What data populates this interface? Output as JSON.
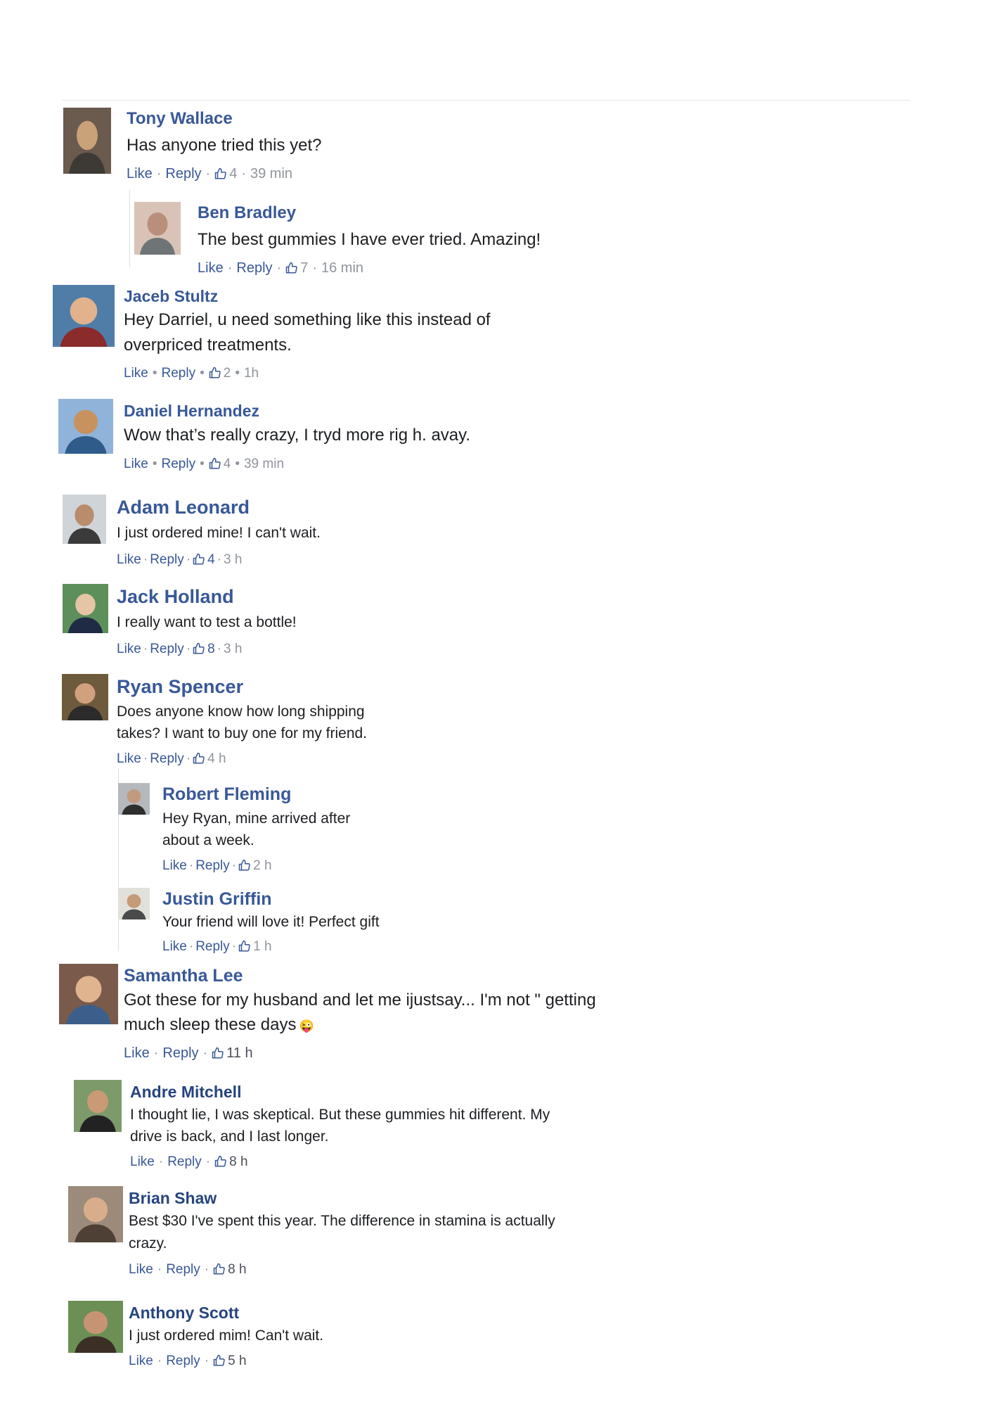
{
  "comments": [
    {
      "name": "Tony Wallace",
      "text": "Has anyone tried this yet?",
      "like": "Like",
      "reply": "Reply",
      "likes": "4",
      "time": "39 min",
      "avatar_colors": [
        "#6b5a4e",
        "#c9a27a",
        "#3d3a36"
      ]
    },
    {
      "name": "Ben Bradley",
      "text": "The best gummies I have ever tried. Amazing!",
      "like": "Like",
      "reply": "Reply",
      "likes": "7",
      "time": "16 min",
      "avatar_colors": [
        "#d9c3b6",
        "#b98f7c",
        "#6f7477"
      ]
    },
    {
      "name": "Jaceb Stultz",
      "text": "Hey Darriel, u need something like this instead of overpriced treatments.",
      "like": "Like",
      "reply": "Reply",
      "likes": "2",
      "time": "1h",
      "avatar_colors": [
        "#4f7da8",
        "#e1b28c",
        "#8b2b2b"
      ]
    },
    {
      "name": "Daniel Hernandez",
      "text": "Wow that’s really crazy, I tryd more rig h. avay.",
      "like": "Like",
      "reply": "Reply",
      "likes": "4",
      "time": "39 min",
      "avatar_colors": [
        "#8fb3d9",
        "#c8925f",
        "#2f5b8a"
      ]
    },
    {
      "name": "Adam Leonard",
      "text": "I just ordered mine! I can't wait.",
      "like": "Like",
      "reply": "Reply",
      "likes": "4",
      "time": "3 h",
      "avatar_colors": [
        "#cfd4d8",
        "#b98c6b",
        "#3a3a3a"
      ]
    },
    {
      "name": "Jack Holland",
      "text": "I really want to test a bottle!",
      "like": "Like",
      "reply": "Reply",
      "likes": "8",
      "time": "3 h",
      "avatar_colors": [
        "#5d8f5a",
        "#e6c4a6",
        "#1f2a44"
      ]
    },
    {
      "name": "Ryan Spencer",
      "text": "Does anyone know how long shipping takes? I want to buy one for my friend.",
      "like": "Like",
      "reply": "Reply",
      "likes": "",
      "time": "4 h",
      "avatar_colors": [
        "#6e5a3c",
        "#d1a07d",
        "#2b2b2b"
      ]
    },
    {
      "name": "Robert Fleming",
      "text": "Hey Ryan, mine arrived after about a week.",
      "like": "Like",
      "reply": "Reply",
      "likes": "",
      "time": "2 h",
      "avatar_colors": [
        "#b5b9bd",
        "#c49a7f",
        "#2e2e2e"
      ]
    },
    {
      "name": "Justin Griffin",
      "text": "Your friend will love it! Perfect gift",
      "like": "Like",
      "reply": "Reply",
      "likes": "",
      "time": "1 h",
      "avatar_colors": [
        "#e2e0da",
        "#c59a77",
        "#4a4a4a"
      ]
    },
    {
      "name": "Samantha Lee",
      "text": "Got these for my husband and let me ijustsay... I'm not \" getting much sleep these days",
      "like": "Like",
      "reply": "Reply",
      "likes": "",
      "time": "11 h",
      "emoji": "😜",
      "avatar_colors": [
        "#7a5a4a",
        "#e0b48f",
        "#3b5f8a"
      ]
    },
    {
      "name": "Andre Mitchell",
      "text": "I thought lie, I was skeptical. But these gummies hit different. My drive is back, and I last longer.",
      "like": "Like",
      "reply": "Reply",
      "likes": "",
      "time": "8 h",
      "avatar_colors": [
        "#7d9a6a",
        "#c99a73",
        "#222222"
      ]
    },
    {
      "name": "Brian Shaw",
      "text": "Best $30 I've spent this year. The difference in stamina is actually crazy.",
      "like": "Like",
      "reply": "Reply",
      "likes": "",
      "time": "8 h",
      "avatar_colors": [
        "#9c8a7a",
        "#d7ad8b",
        "#4e4034"
      ]
    },
    {
      "name": "Anthony Scott",
      "text": "I just ordered mim! Can't wait.",
      "like": "Like",
      "reply": "Reply",
      "likes": "",
      "time": "5 h",
      "avatar_colors": [
        "#6b8f55",
        "#c79473",
        "#3c2f25"
      ]
    }
  ]
}
